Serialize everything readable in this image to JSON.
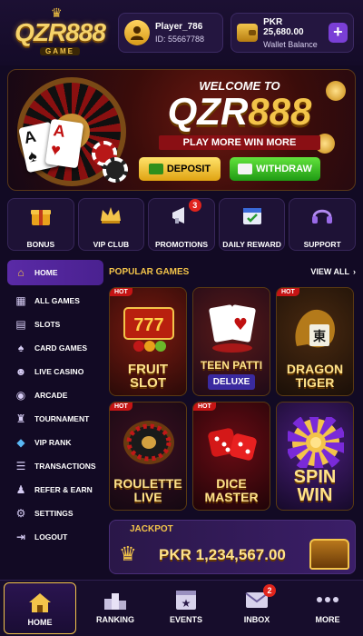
{
  "header": {
    "logo_text": "QZR888",
    "logo_sub": "GAME",
    "player_name": "Player_786",
    "player_id": "ID: 55667788",
    "balance": "PKR 25,680.00",
    "balance_label": "Wallet Balance",
    "add_label": "+"
  },
  "banner": {
    "welcome": "WELCOME TO",
    "brand_a": "QZR",
    "brand_b": "888",
    "tagline": "PLAY MORE WIN MORE",
    "deposit_label": "DEPOSIT",
    "withdraw_label": "WITHDRAW"
  },
  "quick_links": [
    {
      "label": "BONUS",
      "icon": "gift-icon"
    },
    {
      "label": "VIP CLUB",
      "icon": "crown-icon"
    },
    {
      "label": "PROMOTIONS",
      "icon": "megaphone-icon",
      "badge": "3"
    },
    {
      "label": "DAILY REWARD",
      "icon": "calendar-icon"
    },
    {
      "label": "SUPPORT",
      "icon": "headset-icon"
    }
  ],
  "sidebar": {
    "items": [
      {
        "label": "HOME",
        "icon": "home-icon",
        "active": true
      },
      {
        "label": "ALL GAMES",
        "icon": "grid-icon"
      },
      {
        "label": "SLOTS",
        "icon": "slot-icon"
      },
      {
        "label": "CARD GAMES",
        "icon": "cards-icon"
      },
      {
        "label": "LIVE CASINO",
        "icon": "dealer-icon"
      },
      {
        "label": "ARCADE",
        "icon": "gamepad-icon"
      },
      {
        "label": "TOURNAMENT",
        "icon": "trophy-icon"
      },
      {
        "label": "VIP RANK",
        "icon": "diamond-icon"
      },
      {
        "label": "TRANSACTIONS",
        "icon": "list-icon"
      },
      {
        "label": "REFER & EARN",
        "icon": "refer-icon"
      },
      {
        "label": "SETTINGS",
        "icon": "gear-icon"
      },
      {
        "label": "LOGOUT",
        "icon": "logout-icon"
      }
    ]
  },
  "games": {
    "title": "POPULAR GAMES",
    "view_all": "VIEW ALL",
    "hot_label": "HOT",
    "tiles": [
      {
        "line1": "FRUIT",
        "line2": "SLOT"
      },
      {
        "line1": "TEEN PATTI",
        "line2": "DELUXE"
      },
      {
        "line1": "DRAGON",
        "line2": "TIGER"
      },
      {
        "line1": "ROULETTE",
        "line2": "LIVE"
      },
      {
        "line1": "DICE",
        "line2": "MASTER"
      },
      {
        "line1": "SPIN",
        "line2": "WIN"
      }
    ]
  },
  "jackpot": {
    "label": "JACKPOT",
    "amount": "PKR 1,234,567.00"
  },
  "bottom_nav": [
    {
      "label": "HOME",
      "icon": "home-icon",
      "active": true
    },
    {
      "label": "RANKING",
      "icon": "podium-icon"
    },
    {
      "label": "EVENTS",
      "icon": "star-calendar-icon"
    },
    {
      "label": "INBOX",
      "icon": "mail-icon",
      "badge": "2"
    },
    {
      "label": "MORE",
      "icon": "dots-icon"
    }
  ],
  "colors": {
    "background": "#120a24",
    "accent_gold": "#f3c44a",
    "accent_purple": "#5a2aa6",
    "badge_red": "#e0241c"
  }
}
